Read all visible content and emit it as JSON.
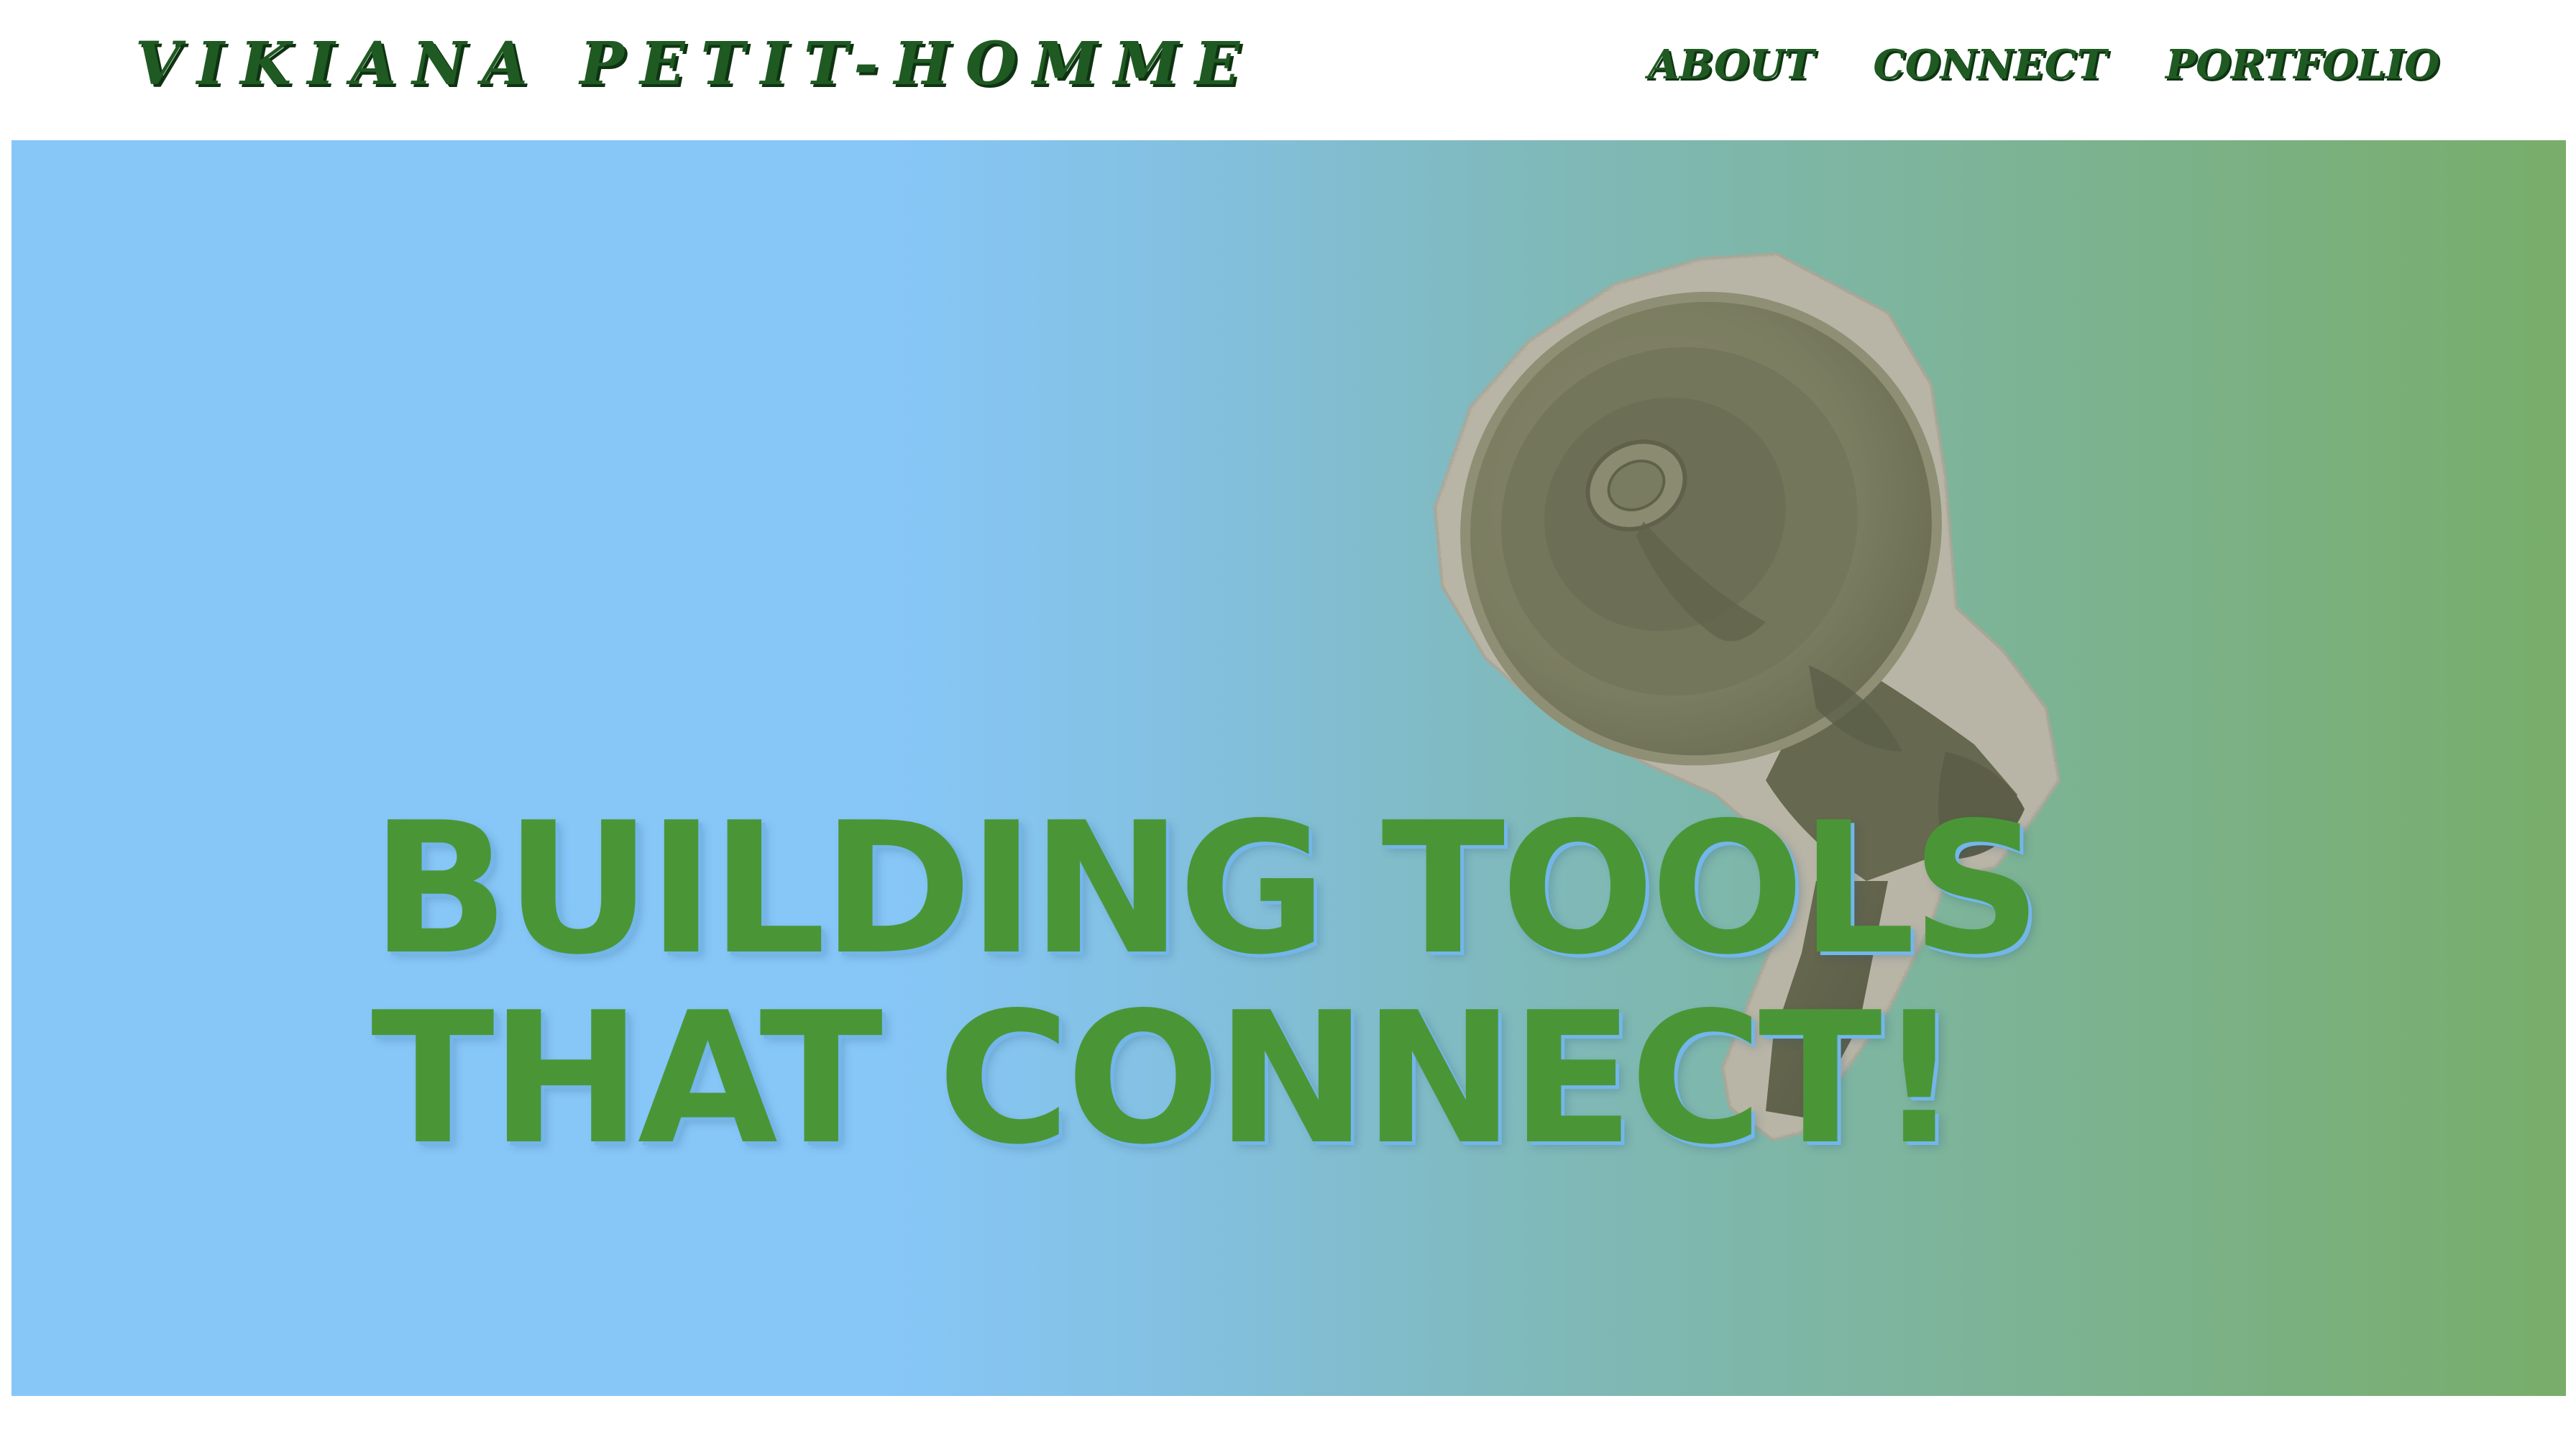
{
  "header": {
    "logo_text": "VIKIANA PETIT-HOMME",
    "nav": [
      {
        "label": "ABOUT"
      },
      {
        "label": "CONNECT"
      },
      {
        "label": "PORTFOLIO"
      }
    ]
  },
  "hero": {
    "heading_lines": [
      "BUILDING TOOLS",
      "THAT CONNECT!"
    ],
    "image": "megaphone-illustration"
  },
  "colors": {
    "brand_green_dark": "#1f5a22",
    "heading_green": "#4a9637",
    "gradient_start": "#87c7f8",
    "gradient_end": "#78ad6a"
  }
}
